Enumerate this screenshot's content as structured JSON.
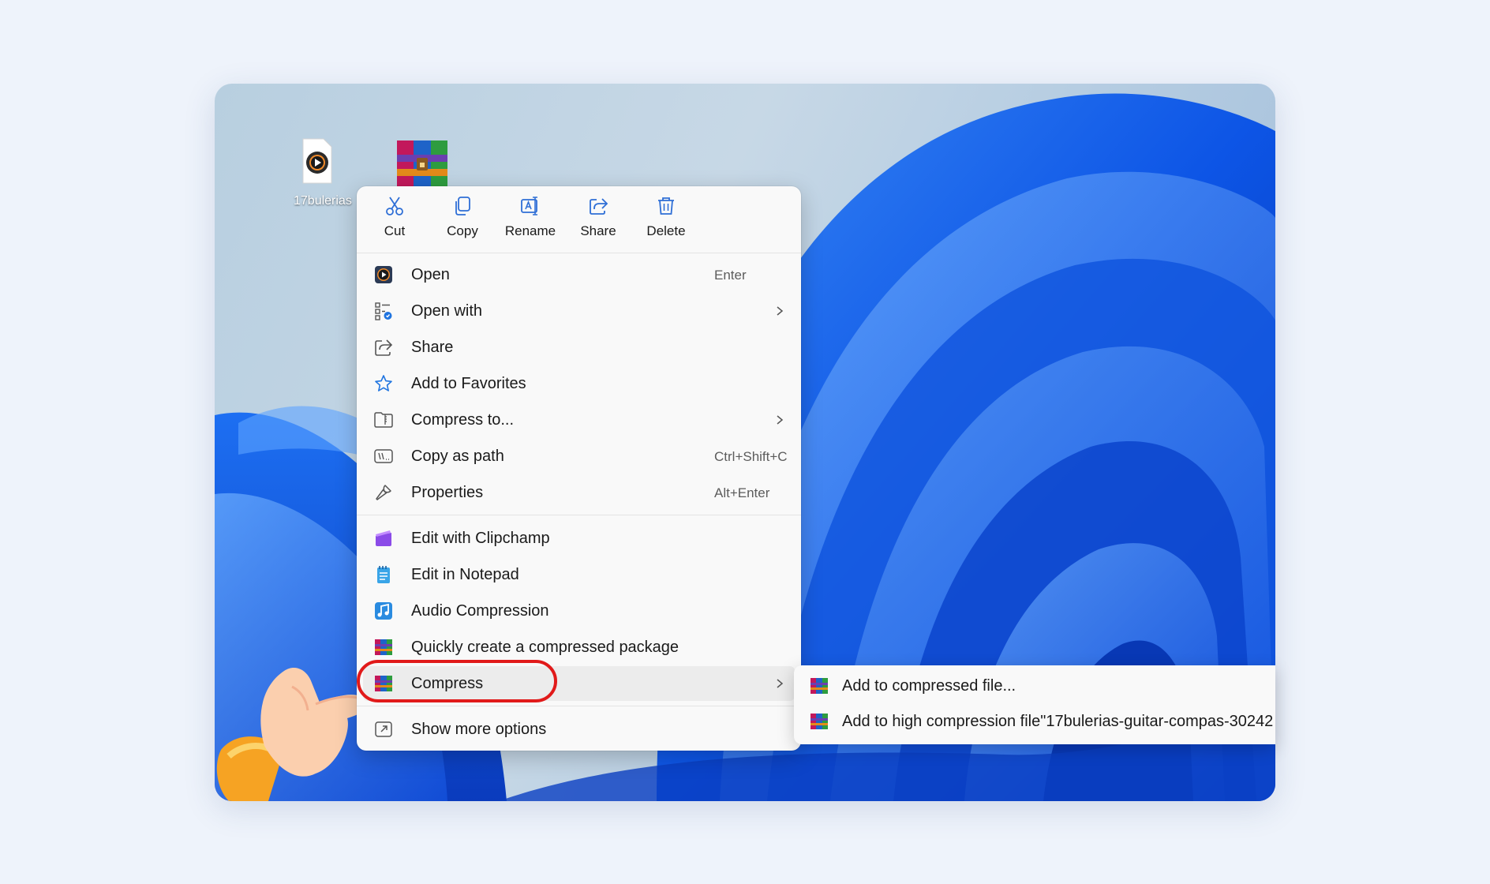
{
  "desktop": {
    "file_icon_label": "17bulerias",
    "archive_icon_name": "winrar-archive-icon"
  },
  "toolbar": [
    {
      "label": "Cut",
      "icon": "scissors-icon"
    },
    {
      "label": "Copy",
      "icon": "copy-icon"
    },
    {
      "label": "Rename",
      "icon": "rename-icon"
    },
    {
      "label": "Share",
      "icon": "share-icon"
    },
    {
      "label": "Delete",
      "icon": "trash-icon"
    }
  ],
  "menu": {
    "group1": [
      {
        "label": "Open",
        "shortcut": "Enter",
        "icon": "media-player-icon"
      },
      {
        "label": "Open with",
        "icon": "open-with-icon",
        "submenu": true
      },
      {
        "label": "Share",
        "icon": "share-icon"
      },
      {
        "label": "Add to Favorites",
        "icon": "star-icon"
      },
      {
        "label": "Compress to...",
        "icon": "zip-folder-icon",
        "submenu": true
      },
      {
        "label": "Copy as path",
        "shortcut": "Ctrl+Shift+C",
        "icon": "copy-path-icon"
      },
      {
        "label": "Properties",
        "shortcut": "Alt+Enter",
        "icon": "wrench-icon"
      }
    ],
    "group2": [
      {
        "label": "Edit with Clipchamp",
        "icon": "clipchamp-icon"
      },
      {
        "label": "Edit in Notepad",
        "icon": "notepad-icon"
      },
      {
        "label": "Audio Compression",
        "icon": "audio-icon"
      },
      {
        "label": "Quickly create a compressed package",
        "icon": "winrar-icon"
      },
      {
        "label": "Compress",
        "icon": "winrar-icon",
        "submenu": true
      }
    ],
    "group3": [
      {
        "label": "Show more options",
        "icon": "more-options-icon"
      }
    ]
  },
  "submenu": [
    {
      "label": "Add to compressed file...",
      "icon": "winrar-icon"
    },
    {
      "label": "Add to high compression file\"17bulerias-guitar-compas-30242",
      "icon": "winrar-icon"
    }
  ],
  "colors": {
    "highlight": "#e11a1a",
    "accent": "#0b5cd5"
  }
}
